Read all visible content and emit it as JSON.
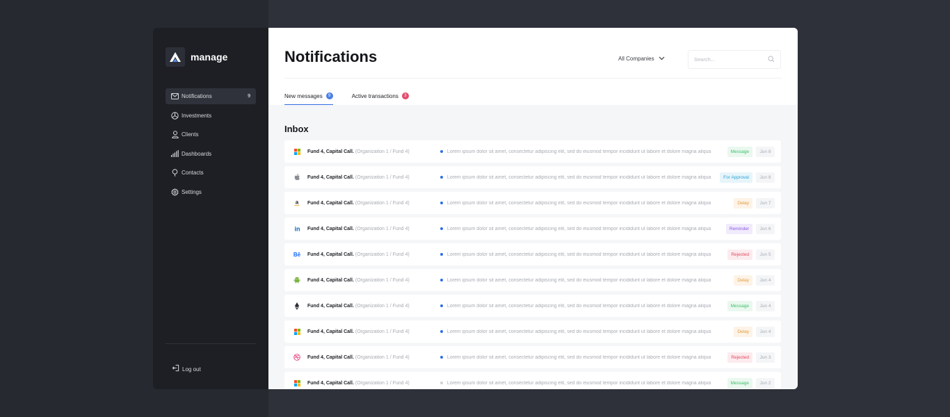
{
  "brand": {
    "name": "manage"
  },
  "colors": {
    "accent": "#2f6fe4",
    "badge_blue": "#4b7fe6",
    "badge_red": "#e44b6c",
    "sidebar_bg": "#1d1f24"
  },
  "sidebar": {
    "items": [
      {
        "label": "Notifications",
        "icon": "envelope-icon",
        "badge": "9",
        "active": true
      },
      {
        "label": "Investments",
        "icon": "pie-chart-icon",
        "badge": "",
        "active": false
      },
      {
        "label": "Clients",
        "icon": "user-icon",
        "badge": "",
        "active": false
      },
      {
        "label": "Dashboards",
        "icon": "signal-bars-icon",
        "badge": "",
        "active": false
      },
      {
        "label": "Contacts",
        "icon": "location-pin-icon",
        "badge": "",
        "active": false
      },
      {
        "label": "Settings",
        "icon": "gear-icon",
        "badge": "",
        "active": false
      }
    ],
    "logout_label": "Log out"
  },
  "header": {
    "title": "Notifications",
    "company_select": "All Companies",
    "search_placeholder": "Search..."
  },
  "tabs": [
    {
      "label": "New messages",
      "count": "9",
      "active": true
    },
    {
      "label": "Active transactions",
      "count": "3",
      "active": false
    }
  ],
  "inbox": {
    "title": "Inbox",
    "rows": [
      {
        "icon": "microsoft-icon",
        "title": "Fund 4, Capital Call.",
        "org": "(Organization 1 / Fund 4)",
        "text": "Lorem ipsum dolor sit amet, consectetur adipiscing elit, sed do eiusmod tempor incididunt ut labore et dolore magna aliqua",
        "unread": true,
        "tag": "Message",
        "date": "Jun 8"
      },
      {
        "icon": "apple-icon",
        "title": "Fund 4, Capital Call.",
        "org": "(Organization 1 / Fund 4)",
        "text": "Lorem ipsum dolor sit amet, consectetur adipiscing elit, sed do eiusmod tempor incididunt ut labore et dolore magna aliqua",
        "unread": true,
        "tag": "For Approval",
        "date": "Jun 8"
      },
      {
        "icon": "amazon-icon",
        "title": "Fund 4, Capital Call.",
        "org": "(Organization 1 / Fund 4)",
        "text": "Lorem ipsum dolor sit amet, consectetur adipiscing elit, sed do eiusmod tempor incididunt ut labore et dolore magna aliqua",
        "unread": true,
        "tag": "Delay",
        "date": "Jun 7"
      },
      {
        "icon": "linkedin-icon",
        "title": "Fund 4, Capital Call.",
        "org": "(Organization 1 / Fund 4)",
        "text": "Lorem ipsum dolor sit amet, consectetur adipiscing elit, sed do eiusmod tempor incididunt ut labore et dolore magna aliqua",
        "unread": true,
        "tag": "Reminder",
        "date": "Jun 6"
      },
      {
        "icon": "behance-icon",
        "title": "Fund 4, Capital Call.",
        "org": "(Organization 1 / Fund 4)",
        "text": "Lorem ipsum dolor sit amet, consectetur adipiscing elit, sed do eiusmod tempor incididunt ut labore et dolore magna aliqua",
        "unread": true,
        "tag": "Rejected",
        "date": "Jun 5"
      },
      {
        "icon": "android-icon",
        "title": "Fund 4, Capital Call.",
        "org": "(Organization 1 / Fund 4)",
        "text": "Lorem ipsum dolor sit amet, consectetur adipiscing elit, sed do eiusmod tempor incididunt ut labore et dolore magna aliqua",
        "unread": true,
        "tag": "Delay",
        "date": "Jun 4"
      },
      {
        "icon": "ethereum-icon",
        "title": "Fund 4, Capital Call.",
        "org": "(Organization 1 / Fund 4)",
        "text": "Lorem ipsum dolor sit amet, consectetur adipiscing elit, sed do eiusmod tempor incididunt ut labore et dolore magna aliqua",
        "unread": true,
        "tag": "Message",
        "date": "Jun 4"
      },
      {
        "icon": "microsoft-icon",
        "title": "Fund 4, Capital Call.",
        "org": "(Organization 1 / Fund 4)",
        "text": "Lorem ipsum dolor sit amet, consectetur adipiscing elit, sed do eiusmod tempor incididunt ut labore et dolore magna aliqua",
        "unread": true,
        "tag": "Delay",
        "date": "Jun 4"
      },
      {
        "icon": "dribbble-icon",
        "title": "Fund 4, Capital Call.",
        "org": "(Organization 1 / Fund 4)",
        "text": "Lorem ipsum dolor sit amet, consectetur adipiscing elit, sed do eiusmod tempor incididunt ut labore et dolore magna aliqua",
        "unread": true,
        "tag": "Rejected",
        "date": "Jun 3"
      },
      {
        "icon": "microsoft-icon",
        "title": "Fund 4, Capital Call.",
        "org": "(Organization 1 / Fund 4)",
        "text": "Lorem ipsum dolor sit amet, consectetur adipiscing elit, sed do eiusmod tempor incididunt ut labore et dolore magna aliqua",
        "unread": false,
        "tag": "Message",
        "date": "Jun 2"
      }
    ]
  },
  "tag_styles": {
    "Message": {
      "color": "#3fbf6b",
      "background": "#eaf8ef"
    },
    "For Approval": {
      "color": "#2aa3d6",
      "background": "#e7f5fb"
    },
    "Delay": {
      "color": "#e39b3c",
      "background": "#fdf3e6"
    },
    "Reminder": {
      "color": "#8c58e6",
      "background": "#f1ebfc"
    },
    "Rejected": {
      "color": "#e2485d",
      "background": "#fcebee"
    }
  }
}
